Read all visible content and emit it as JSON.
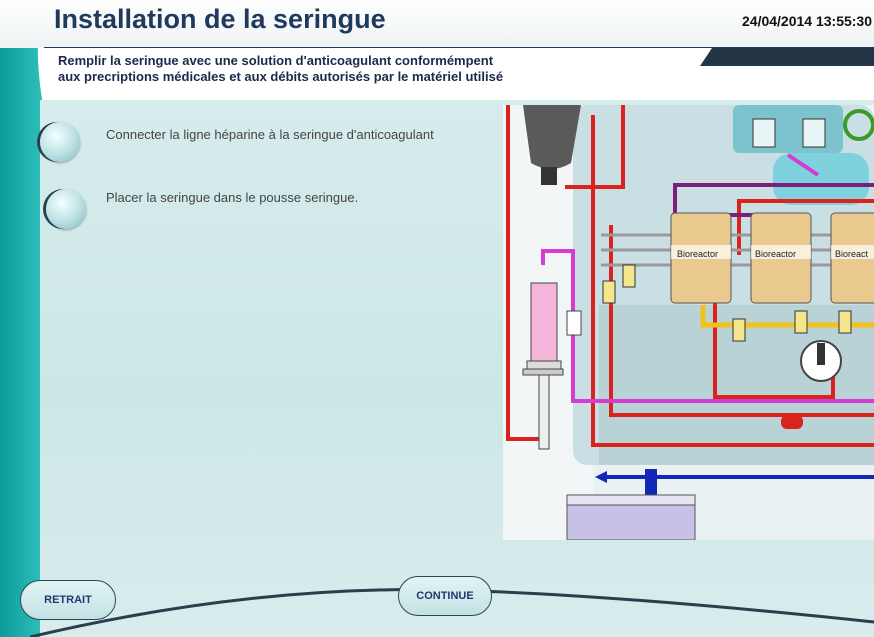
{
  "header": {
    "title": "Installation de la seringue",
    "datetime": "24/04/2014  13:55:30"
  },
  "instruction": {
    "line1": "Remplir la seringue avec une solution d'anticoagulant conformémpent",
    "line2": "aux precriptions médicales et aux débits autorisés par le matériel utilisé"
  },
  "steps": [
    {
      "text": "Connecter la ligne héparine à la seringue d'anticoagulant"
    },
    {
      "text": "Placer la seringue dans le pousse seringue."
    }
  ],
  "diagram": {
    "bioreactor_labels": [
      "Bioreactor",
      "Bioreactor",
      "Bioreact"
    ]
  },
  "footer": {
    "retrait_label": "RETRAIT",
    "continue_label": "CONTINUE"
  },
  "colors": {
    "title": "#1f3a5c",
    "accent_teal": "#1aa3a3",
    "line_red": "#d9231c",
    "line_magenta": "#d63cd0",
    "line_purple": "#7a1f7a",
    "line_yellow": "#f2c21a",
    "line_blue": "#1226b8"
  }
}
